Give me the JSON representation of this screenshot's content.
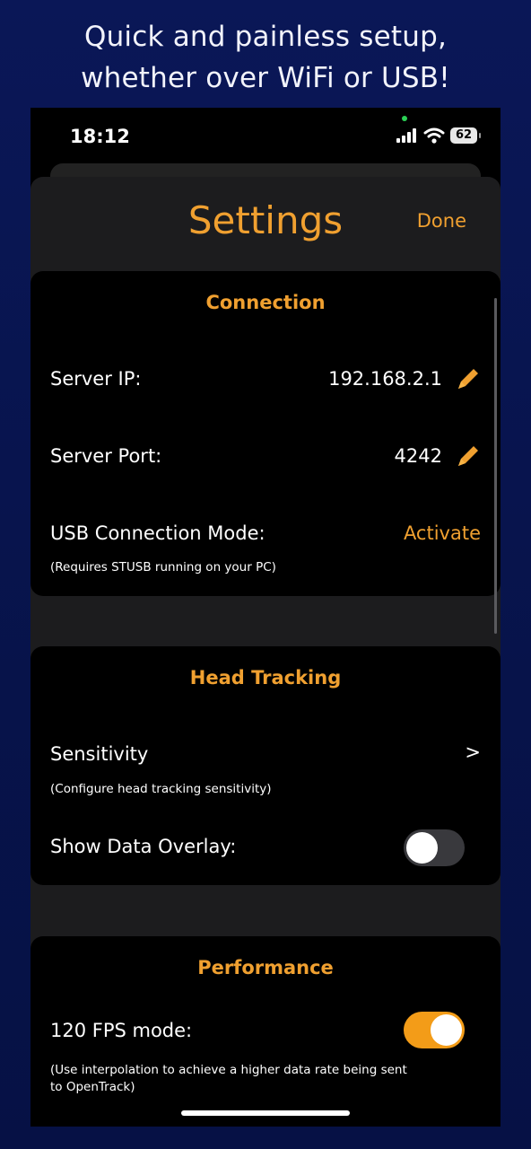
{
  "promo": {
    "line1": "Quick and painless setup,",
    "line2": "whether over WiFi or USB!"
  },
  "status_bar": {
    "time": "18:12",
    "battery": "62"
  },
  "header": {
    "title": "Settings",
    "done_label": "Done"
  },
  "connection": {
    "title": "Connection",
    "server_ip_label": "Server IP:",
    "server_ip_value": "192.168.2.1",
    "server_port_label": "Server Port:",
    "server_port_value": "4242",
    "usb_label": "USB Connection Mode:",
    "usb_action": "Activate",
    "usb_note": "(Requires STUSB running on your PC)"
  },
  "head_tracking": {
    "title": "Head Tracking",
    "sensitivity_label": "Sensitivity",
    "sensitivity_chevron": ">",
    "sensitivity_note": "(Configure head tracking sensitivity)",
    "overlay_label": "Show Data Overlay:",
    "overlay_on": false
  },
  "performance": {
    "title": "Performance",
    "fps_label": "120 FPS mode:",
    "fps_on": true,
    "fps_note": "(Use interpolation to achieve a higher data rate being sent to OpenTrack)"
  },
  "colors": {
    "accent": "#f0a030",
    "toggle_on": "#f39c18",
    "toggle_off": "#39393d"
  }
}
